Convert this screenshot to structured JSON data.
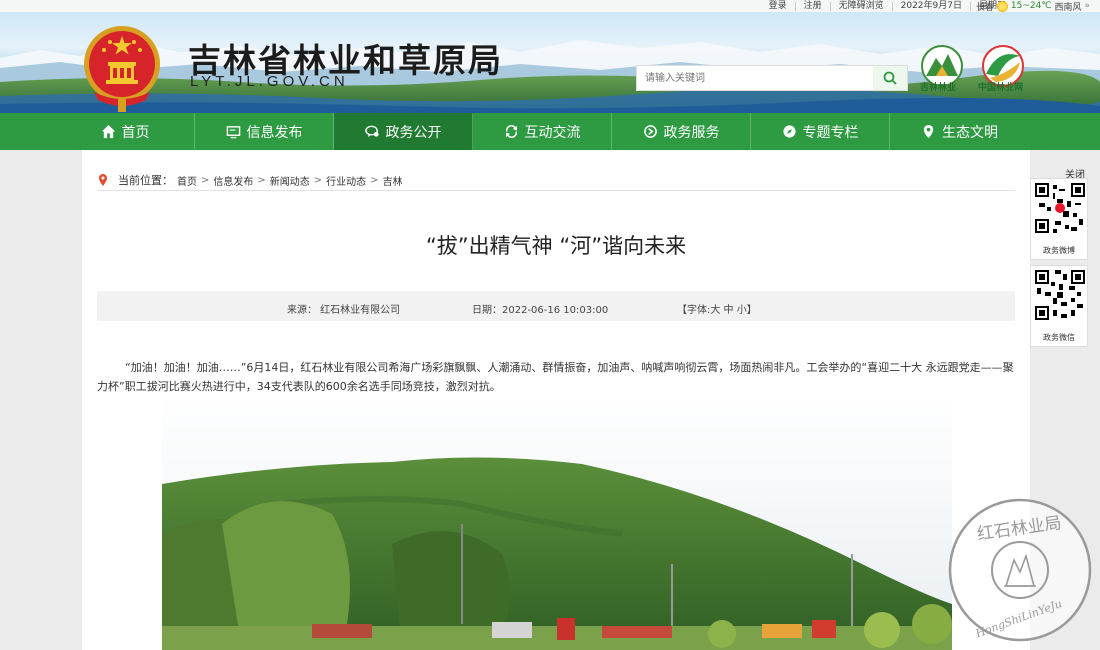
{
  "topbar": {
    "items": [
      "登录",
      "注册",
      "无障碍浏览",
      "2022年9月7日",
      "星期三"
    ],
    "city": "长春",
    "temperature": "15~24℃",
    "wind": "西南风",
    "more_icon": "double-chevron-right-icon"
  },
  "header": {
    "title": "吉林省林业和草原局",
    "domain": "LYT.JL.GOV.CN",
    "search_placeholder": "请输入关键词",
    "logos": [
      {
        "caption": "吉林林业"
      },
      {
        "caption": "中国林业网"
      }
    ]
  },
  "nav": {
    "items": [
      {
        "label": "首页",
        "icon": "home-icon"
      },
      {
        "label": "信息发布",
        "icon": "monitor-icon"
      },
      {
        "label": "政务公开",
        "icon": "chat-icon",
        "active": true
      },
      {
        "label": "互动交流",
        "icon": "refresh-icon"
      },
      {
        "label": "政务服务",
        "icon": "service-icon"
      },
      {
        "label": "专题专栏",
        "icon": "compass-icon"
      },
      {
        "label": "生态文明",
        "icon": "leaf-pin-icon"
      }
    ]
  },
  "breadcrumb": {
    "label": "当前位置：",
    "items": [
      "首页",
      "信息发布",
      "新闻动态",
      "行业动态",
      "吉林"
    ],
    "separator": ">"
  },
  "article": {
    "title": "“拔”出精气神 “河”谐向未来",
    "source": "来源： 红石林业有限公司",
    "date": "日期：2022-06-16 10:03:00",
    "fontsize": "【字体:大 中 小】",
    "body": "“加油！加油！加油……”6月14日，红石林业有限公司希海广场彩旗飘飘、人潮涌动、群情振奋，加油声、呐喊声响彻云霄，场面热闹非凡。工会举办的“喜迎二十大 永远跟党走——聚力杯”职工拔河比赛火热进行中，34支代表队的600余名选手同场竞技，激烈对抗。"
  },
  "side": {
    "close": "关闭",
    "qr": [
      {
        "caption": "政务微博"
      },
      {
        "caption": "政务微信"
      }
    ]
  },
  "watermark": {
    "text": "红石林业局 HongShiLinYeJu"
  },
  "colors": {
    "nav_green": "#2e9b42",
    "nav_active": "#207a31",
    "accent_green": "#1d6f2b"
  }
}
